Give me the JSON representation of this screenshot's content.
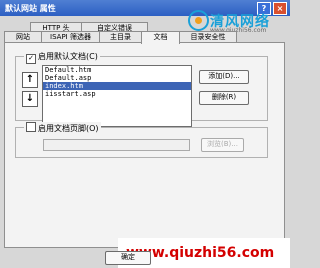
{
  "window": {
    "title": "默认网站 属性",
    "help_glyph": "?",
    "close_glyph": "×"
  },
  "watermark_top": {
    "text": "清风网络",
    "url": "www.qiuzhi56.com"
  },
  "tabs": {
    "row1": [
      "HTTP 头",
      "自定义错误"
    ],
    "row2": [
      "网站",
      "ISAPI 筛选器",
      "主目录",
      "文档",
      "目录安全性"
    ]
  },
  "default_docs": {
    "label": "启用默认文档(C)",
    "checked": true,
    "items": [
      "Default.htm",
      "Default.asp",
      "index.htm",
      "iisstart.asp"
    ],
    "selected_index": 2,
    "move_up": "↑",
    "move_down": "↓",
    "add_label": "添加(D)...",
    "remove_label": "删除(R)"
  },
  "footer_docs": {
    "label": "启用文档页脚(O)",
    "checked": false,
    "browse_label": "浏览(B)..."
  },
  "ok_label": "确定",
  "bottom_watermark": "www.qiuzhi56.com"
}
